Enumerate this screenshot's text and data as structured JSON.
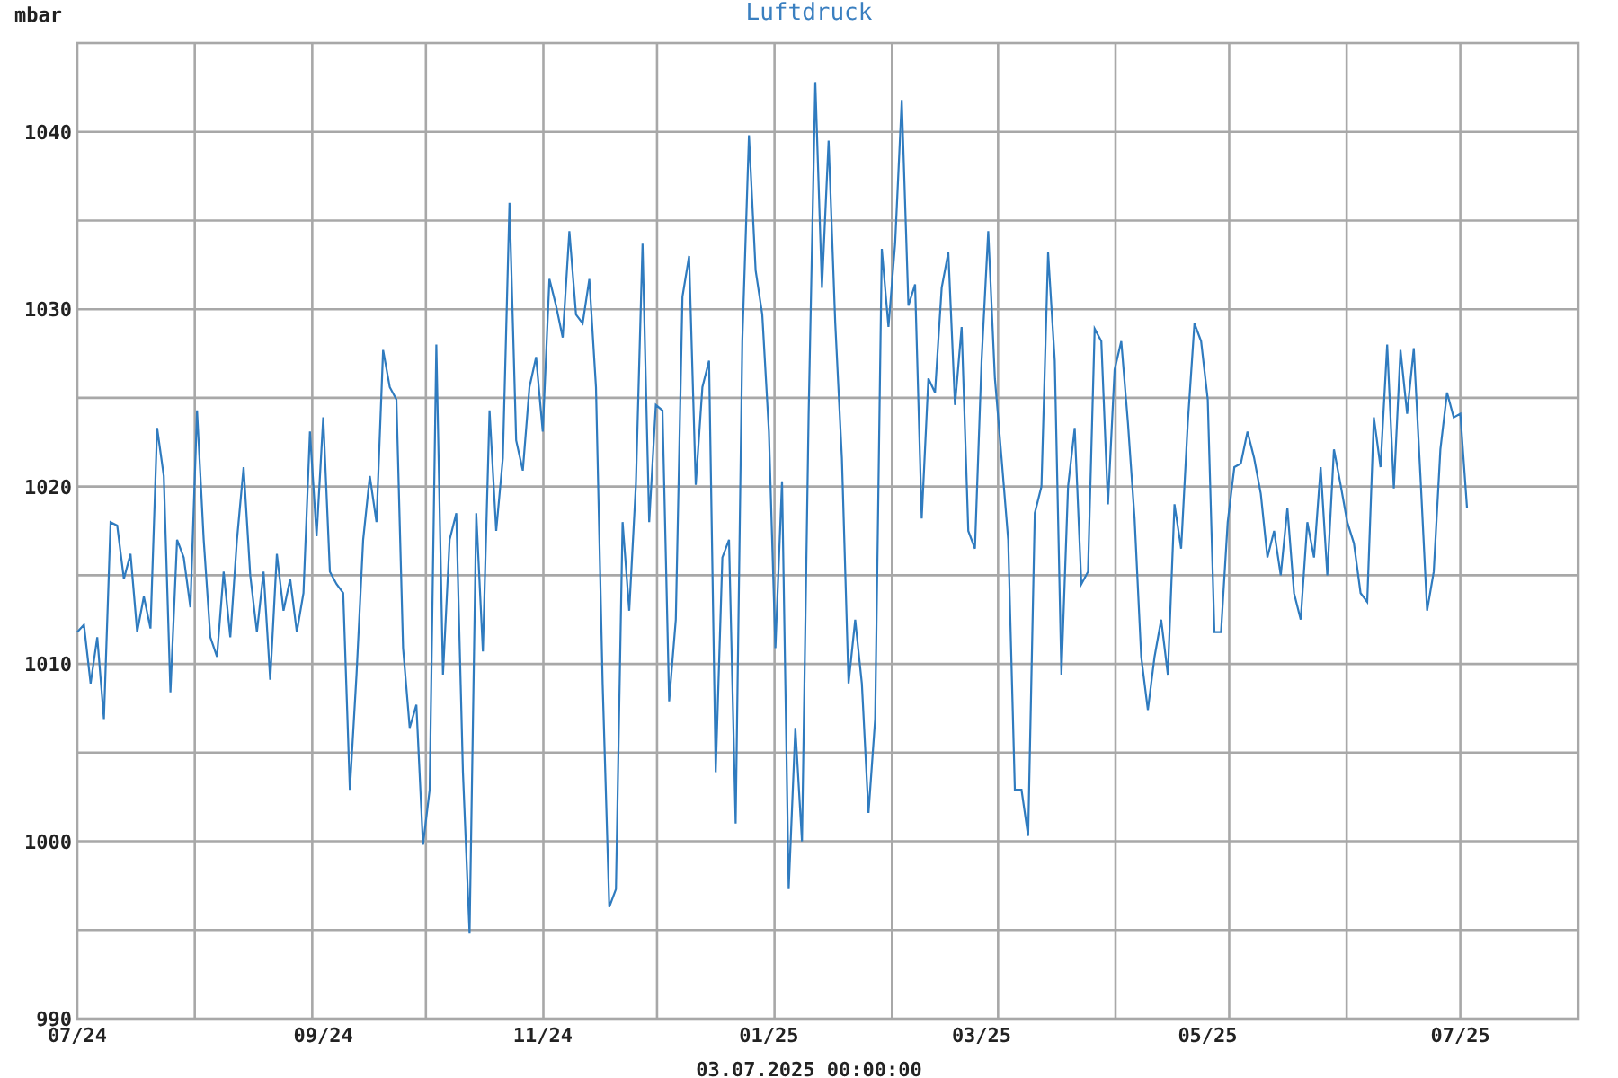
{
  "chart": {
    "chart_data": {
      "type": "line",
      "title": "Luftdruck",
      "ylabel": "mbar",
      "grid": true,
      "ylim": [
        990,
        1045
      ],
      "categories": [
        "07/24",
        null,
        null,
        null,
        null,
        null,
        null,
        null,
        null,
        null,
        null,
        null,
        null,
        null,
        null,
        null,
        null,
        null,
        null,
        null,
        null,
        null,
        null,
        null,
        null,
        null,
        null,
        null,
        null,
        null,
        null,
        null,
        null,
        null,
        null,
        null,
        null,
        "09/24",
        null,
        null,
        null,
        null,
        null,
        null,
        null,
        null,
        null,
        null,
        null,
        null,
        null,
        null,
        null,
        null,
        null,
        null,
        null,
        null,
        null,
        null,
        null,
        null,
        null,
        null,
        null,
        null,
        null,
        null,
        null,
        null,
        "11/24",
        null,
        null,
        null,
        null,
        null,
        null,
        null,
        null,
        null,
        null,
        null,
        null,
        null,
        null,
        null,
        null,
        null,
        null,
        null,
        null,
        null,
        null,
        null,
        null,
        null,
        null,
        null,
        null,
        null,
        null,
        null,
        null,
        null,
        "01/25",
        null,
        null,
        null,
        null,
        null,
        null,
        null,
        null,
        null,
        null,
        null,
        null,
        null,
        null,
        null,
        null,
        null,
        null,
        null,
        null,
        null,
        null,
        null,
        null,
        null,
        null,
        null,
        null,
        null,
        null,
        null,
        "03/25",
        null,
        null,
        null,
        null,
        null,
        null,
        null,
        null,
        null,
        null,
        null,
        null,
        null,
        null,
        null,
        null,
        null,
        null,
        null,
        null,
        null,
        null,
        null,
        null,
        null,
        null,
        null,
        null,
        null,
        null,
        null,
        null,
        null,
        "05/25",
        null,
        null,
        null,
        null,
        null,
        null,
        null,
        null,
        null,
        null,
        null,
        null,
        null,
        null,
        null,
        null,
        null,
        null,
        null,
        null,
        null,
        null,
        null,
        null,
        null,
        null,
        null,
        null,
        null,
        null,
        null,
        null,
        null,
        null,
        null,
        null,
        null,
        "07/25",
        null
      ],
      "yticks": [
        990,
        1000,
        1010,
        1020,
        1030,
        1040
      ],
      "series": [
        {
          "color": "#2f7bbf",
          "values": [
            1011.8,
            1012.2,
            1008.9,
            1011.5,
            1006.9,
            1018,
            1017.8,
            1014.8,
            1016.2,
            1011.8,
            1013.8,
            1012,
            1023.3,
            1020.6,
            1008.4,
            1017,
            1016,
            1013.2,
            1024.3,
            1017,
            1011.5,
            1010.4,
            1015.2,
            1011.5,
            1017,
            1021.1,
            1015,
            1011.8,
            1015.2,
            1009.1,
            1016.2,
            1013,
            1014.8,
            1011.8,
            1014,
            1023.1,
            1017.2,
            1023.9,
            1015.2,
            1014.5,
            1014,
            1002.9,
            1009.4,
            1017,
            1020.6,
            1018,
            1027.7,
            1025.6,
            1024.9,
            1010.9,
            1006.4,
            1007.7,
            999.8,
            1002.9,
            1028,
            1009.4,
            1017,
            1018.5,
            1003.9,
            994.8,
            1018.5,
            1010.7,
            1024.3,
            1017.5,
            1021.6,
            1036,
            1022.6,
            1020.9,
            1025.6,
            1027.3,
            1023.1,
            1031.7,
            1030.2,
            1028.4,
            1034.4,
            1029.7,
            1029.2,
            1031.7,
            1025.6,
            1008.9,
            996.3,
            997.3,
            1018,
            1013,
            1020.1,
            1033.7,
            1018,
            1024.6,
            1024.3,
            1007.9,
            1012.5,
            1030.7,
            1033,
            1020.1,
            1025.6,
            1027.1,
            1003.9,
            1016,
            1017,
            1001,
            1028.2,
            1039.8,
            1032.2,
            1029.7,
            1023.1,
            1010.9,
            1020.3,
            997.3,
            1006.4,
            1000,
            1024.1,
            1042.8,
            1031.2,
            1039.5,
            1029.2,
            1021.6,
            1008.9,
            1012.5,
            1008.9,
            1001.6,
            1006.9,
            1033.4,
            1029,
            1033.7,
            1041.8,
            1030.2,
            1031.4,
            1018.2,
            1026.1,
            1025.3,
            1031.2,
            1033.2,
            1024.6,
            1029,
            1017.5,
            1016.5,
            1027.1,
            1034.4,
            1026.1,
            1021.6,
            1017,
            1002.9,
            1002.9,
            1000.3,
            1018.5,
            1020,
            1033.2,
            1027.1,
            1009.4,
            1020,
            1023.3,
            1014.5,
            1015.2,
            1028.9,
            1028.2,
            1019,
            1026.6,
            1028.2,
            1023.6,
            1018.2,
            1010.4,
            1007.4,
            1010.4,
            1012.5,
            1009.4,
            1019,
            1016.5,
            1023.6,
            1029.2,
            1028.2,
            1024.9,
            1011.8,
            1011.8,
            1018,
            1021.1,
            1021.3,
            1023.1,
            1021.6,
            1019.6,
            1016,
            1017.5,
            1015,
            1018.8,
            1014,
            1012.5,
            1018,
            1016,
            1021.1,
            1015,
            1022.1,
            1020.1,
            1018,
            1016.8,
            1014,
            1013.5,
            1023.9,
            1021.1,
            1028,
            1019.9,
            1027.7,
            1024.1,
            1027.8,
            1020.6,
            1013,
            1015.2,
            1022.1,
            1025.3,
            1023.9,
            1024.1,
            1018.8
          ]
        }
      ]
    }
  },
  "footer": {
    "timestamp": "03.07.2025 00:00:00"
  }
}
